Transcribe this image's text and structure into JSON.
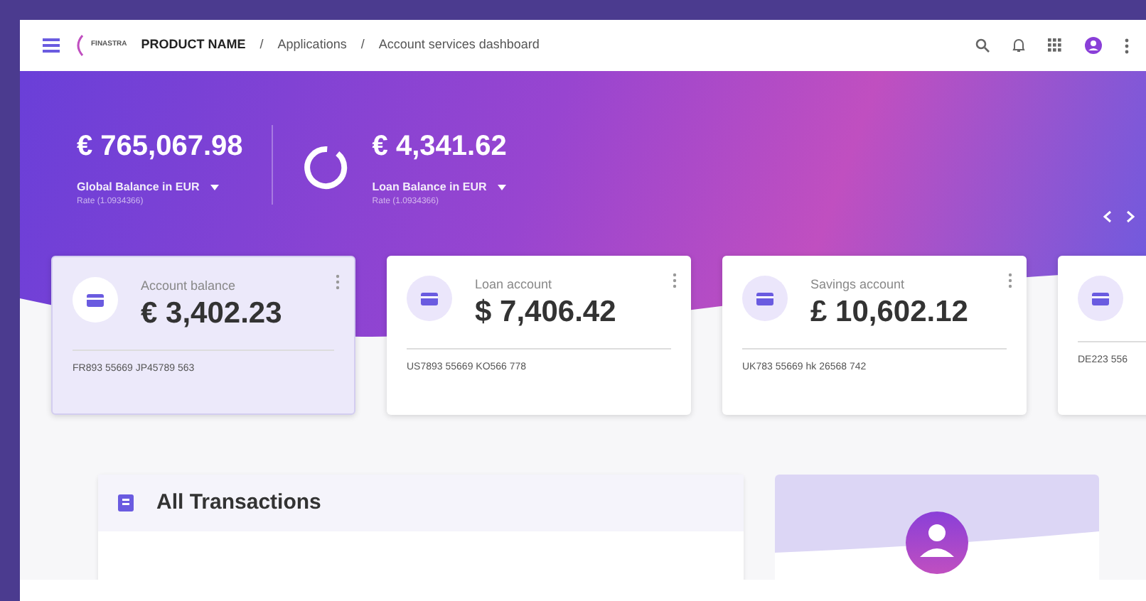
{
  "header": {
    "product_name": "PRODUCT NAME",
    "logo_text": "FINASTRA",
    "breadcrumbs": [
      {
        "separator": "/",
        "label": "Applications"
      },
      {
        "separator": "/",
        "label": "Account services dashboard"
      }
    ]
  },
  "summary": [
    {
      "kind": "plain",
      "amount": "€ 765,067.98",
      "label": "Global Balance in EUR",
      "rate": "Rate (1.0934366)"
    },
    {
      "kind": "ring",
      "amount": "€ 4,341.62",
      "label": "Loan Balance in EUR",
      "rate": "Rate (1.0934366)"
    }
  ],
  "accounts": [
    {
      "title": "Account balance",
      "amount": "€ 3,402.23",
      "iban": "FR893 55669 JP45789 563",
      "selected": true
    },
    {
      "title": "Loan account",
      "amount": "$ 7,406.42",
      "iban": "US7893 55669 KO566 778",
      "selected": false
    },
    {
      "title": "Savings account",
      "amount": "£ 10,602.12",
      "iban": "UK783 55669 hk 26568 742",
      "selected": false
    },
    {
      "iban": "DE223 556",
      "selected": false
    }
  ],
  "transactions": {
    "title": "All Transactions"
  }
}
